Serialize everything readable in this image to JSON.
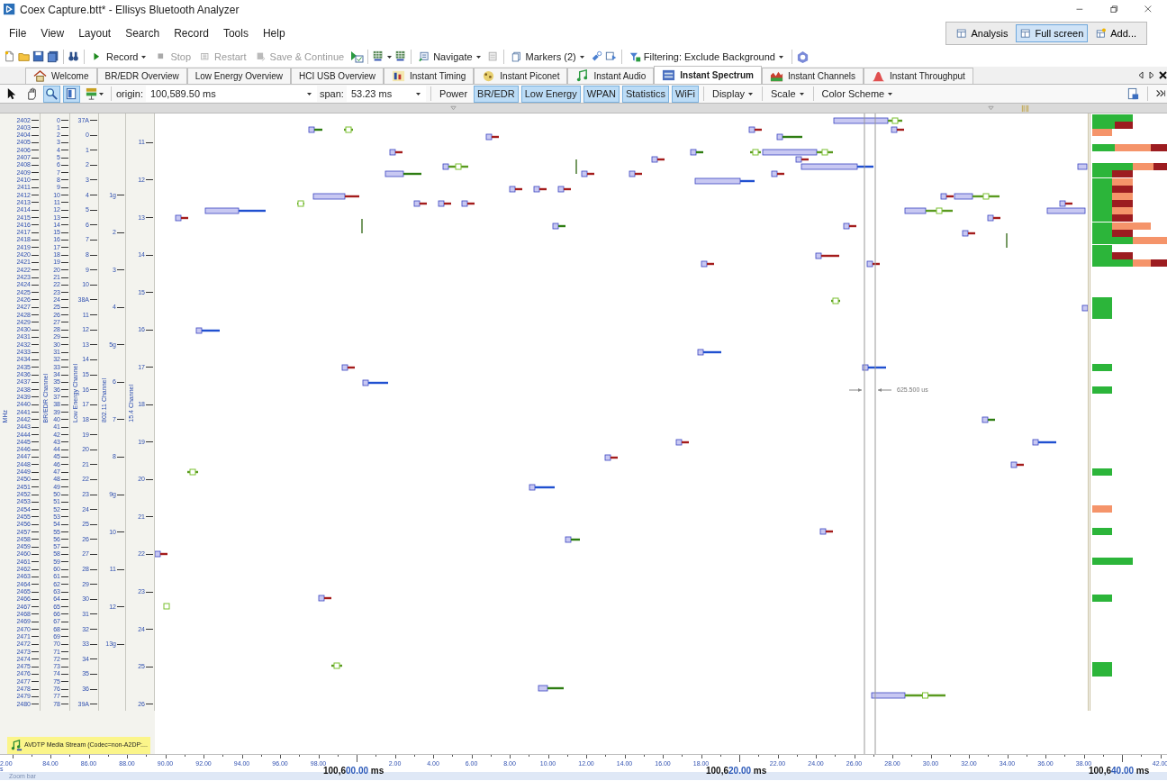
{
  "window": {
    "title": "Coex Capture.btt* - Ellisys Bluetooth Analyzer"
  },
  "menu": [
    "File",
    "View",
    "Layout",
    "Search",
    "Record",
    "Tools",
    "Help"
  ],
  "layouts": [
    {
      "label": "Analysis",
      "selected": false
    },
    {
      "label": "Full screen",
      "selected": true
    },
    {
      "label": "Add...",
      "selected": false
    }
  ],
  "toolbar": [
    {
      "label": "Record",
      "disabled": false,
      "dropdown": true
    },
    {
      "label": "Stop",
      "disabled": true,
      "dropdown": false
    },
    {
      "label": "Restart",
      "disabled": true,
      "dropdown": false
    },
    {
      "label": "Save & Continue",
      "disabled": true,
      "dropdown": false
    },
    {
      "label": "Navigate",
      "disabled": false,
      "dropdown": true
    },
    {
      "label": "Markers (2)",
      "disabled": false,
      "dropdown": true
    },
    {
      "label": "Filtering: Exclude Background",
      "disabled": false,
      "dropdown": true
    }
  ],
  "tabs": [
    {
      "label": "Welcome",
      "selected": false
    },
    {
      "label": "BR/EDR Overview",
      "selected": false
    },
    {
      "label": "Low Energy Overview",
      "selected": false
    },
    {
      "label": "HCI USB Overview",
      "selected": false
    },
    {
      "label": "Instant Timing",
      "selected": false
    },
    {
      "label": "Instant Piconet",
      "selected": false
    },
    {
      "label": "Instant Audio",
      "selected": false
    },
    {
      "label": "Instant Spectrum",
      "selected": true
    },
    {
      "label": "Instant Channels",
      "selected": false
    },
    {
      "label": "Instant Throughput",
      "selected": false
    }
  ],
  "view_toolbar": {
    "tools": [
      {
        "selected": false
      },
      {
        "selected": false
      },
      {
        "selected": true
      },
      {
        "selected": true
      },
      {
        "selected": false
      }
    ],
    "origin": {
      "label": "origin:",
      "value": "100,589.50 ms"
    },
    "span": {
      "label": "span:",
      "value": "53.23 ms"
    },
    "power": "Power",
    "filters": [
      {
        "label": "BR/EDR",
        "on": true
      },
      {
        "label": "Low Energy",
        "on": true
      },
      {
        "label": "WPAN",
        "on": true
      },
      {
        "label": "Statistics",
        "on": true
      },
      {
        "label": "WiFi",
        "on": true
      }
    ],
    "menus": [
      "Display",
      "Scale",
      "Color Scheme"
    ]
  },
  "axes": [
    {
      "title": "MHz",
      "labels": [
        "2402",
        "2403",
        "2404",
        "2405",
        "2406",
        "2407",
        "2408",
        "2409",
        "2410",
        "2411",
        "2412",
        "2413",
        "2414",
        "2415",
        "2416",
        "2417",
        "2418",
        "2419",
        "2420",
        "2421",
        "2422",
        "2423",
        "2424",
        "2425",
        "2426",
        "2427",
        "2428",
        "2429",
        "2430",
        "2431",
        "2432",
        "2433",
        "2434",
        "2435",
        "2436",
        "2437",
        "2438",
        "2439",
        "2440",
        "2441",
        "2442",
        "2443",
        "2444",
        "2445",
        "2446",
        "2447",
        "2448",
        "2449",
        "2450",
        "2451",
        "2452",
        "2453",
        "2454",
        "2455",
        "2456",
        "2457",
        "2458",
        "2459",
        "2460",
        "2461",
        "2462",
        "2463",
        "2464",
        "2465",
        "2466",
        "2467",
        "2468",
        "2469",
        "2470",
        "2471",
        "2472",
        "2473",
        "2474",
        "2475",
        "2476",
        "2477",
        "2478",
        "2479",
        "2480"
      ]
    },
    {
      "title": "BR/EDR Channel",
      "labels": [
        "0",
        "1",
        "2",
        "3",
        "4",
        "5",
        "6",
        "7",
        "8",
        "9",
        "10",
        "11",
        "12",
        "13",
        "14",
        "15",
        "16",
        "17",
        "18",
        "19",
        "20",
        "21",
        "22",
        "23",
        "24",
        "25",
        "26",
        "27",
        "28",
        "29",
        "30",
        "31",
        "32",
        "33",
        "34",
        "35",
        "36",
        "37",
        "38",
        "39",
        "40",
        "41",
        "42",
        "43",
        "44",
        "45",
        "46",
        "47",
        "48",
        "49",
        "50",
        "51",
        "52",
        "53",
        "54",
        "55",
        "56",
        "57",
        "58",
        "59",
        "60",
        "61",
        "62",
        "63",
        "64",
        "65",
        "66",
        "67",
        "68",
        "69",
        "70",
        "71",
        "72",
        "73",
        "74",
        "75",
        "76",
        "77",
        "78"
      ]
    },
    {
      "title": "Low Energy Channel",
      "labels": [
        "37A",
        "0",
        "1",
        "2",
        "3",
        "4",
        "5",
        "6",
        "7",
        "8",
        "9",
        "10",
        "38A",
        "11",
        "12",
        "13",
        "14",
        "15",
        "16",
        "17",
        "18",
        "19",
        "20",
        "21",
        "22",
        "23",
        "24",
        "25",
        "26",
        "27",
        "28",
        "29",
        "30",
        "31",
        "32",
        "33",
        "34",
        "35",
        "36",
        "39A"
      ]
    },
    {
      "title": "802.11 Channel",
      "labels": [
        "1g",
        "2",
        "3",
        "4",
        "5g",
        "6",
        "7",
        "8",
        "9g",
        "10",
        "11",
        "12",
        "13g"
      ]
    },
    {
      "title": "15.4 Channel",
      "labels": [
        "11",
        "12",
        "13",
        "14",
        "15",
        "16",
        "17",
        "18",
        "19",
        "20",
        "21",
        "22",
        "23",
        "24",
        "25",
        "26"
      ]
    }
  ],
  "marker": {
    "label": "625.500 us"
  },
  "stream": {
    "label": "AVDTP Media Stream (Codec=non-A2DP:..."
  },
  "time_axis": {
    "cut_unit": "s",
    "ticks": [
      "2.00",
      "84.00",
      "86.00",
      "88.00",
      "90.00",
      "92.00",
      "94.00",
      "96.00",
      "98.00",
      "2.00",
      "4.00",
      "6.00",
      "8.00",
      "10.00",
      "12.00",
      "14.00",
      "16.00",
      "18.00",
      "22.00",
      "24.00",
      "26.00",
      "28.00",
      "30.00",
      "32.00",
      "34.00",
      "36.00",
      "38.00",
      "42.00"
    ],
    "majors": [
      {
        "prefix": "100,6",
        "suffix": "00.00",
        "unit": "ms"
      },
      {
        "prefix": "100,6",
        "suffix": "20.00",
        "unit": "ms"
      },
      {
        "prefix": "100,6",
        "suffix": "40.00",
        "unit": "ms"
      }
    ]
  },
  "zoom_bar": "Zoom bar"
}
